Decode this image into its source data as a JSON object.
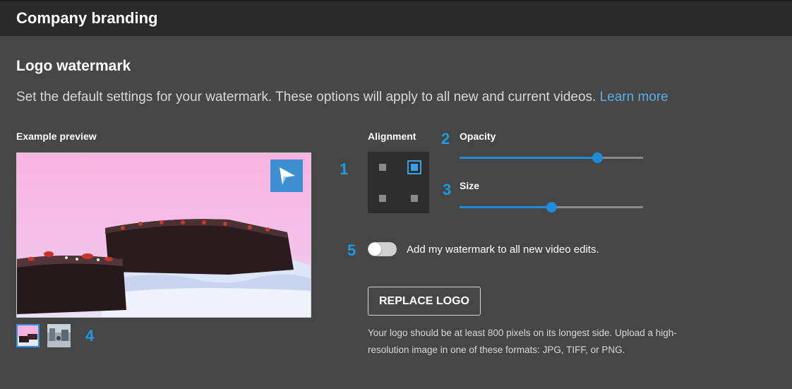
{
  "header": {
    "title": "Company branding"
  },
  "section": {
    "title": "Logo watermark",
    "description": "Set the default settings for your watermark. These options will apply to all new and current videos.",
    "learn_more": "Learn more"
  },
  "preview": {
    "label": "Example preview",
    "watermark_icon": "arrow-logo-icon",
    "thumbnails": [
      {
        "name": "cake-thumbnail",
        "selected": true
      },
      {
        "name": "street-thumbnail",
        "selected": false
      }
    ]
  },
  "alignment": {
    "label": "Alignment",
    "positions": [
      "top-left",
      "top-right",
      "bottom-left",
      "bottom-right"
    ],
    "selected": "top-right"
  },
  "opacity": {
    "label": "Opacity",
    "value_fraction": 0.75
  },
  "size": {
    "label": "Size",
    "value_fraction": 0.5
  },
  "toggle": {
    "label": "Add my watermark to all new video edits.",
    "on": false
  },
  "replace_button": {
    "label": "REPLACE LOGO"
  },
  "help_text": "Your logo should be at least 800 pixels on its longest side. Upload a high-resolution image in one of these formats: JPG, TIFF, or PNG.",
  "annotations": [
    "1",
    "2",
    "3",
    "4",
    "5"
  ],
  "colors": {
    "accent": "#1e8cd8",
    "annotation": "#1e9ae0",
    "link": "#5aaee6",
    "background": "#464646",
    "header": "#2a2a2a"
  }
}
